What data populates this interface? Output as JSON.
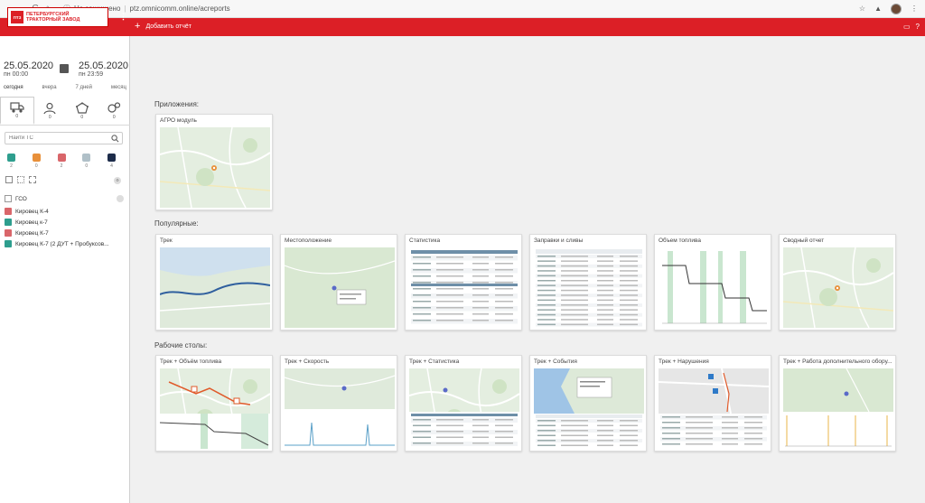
{
  "browser": {
    "back": "←",
    "forward": "→",
    "reload": "C",
    "home": "⌂",
    "security": "Не защищено",
    "url": "ptz.omnicomm.online/acreports"
  },
  "topbar": {
    "add_report": "Добавить отчёт",
    "add_icon": "+"
  },
  "logo": {
    "mark": "ПТЗ",
    "line1": "ПЕТЕРБУРГСКИЙ",
    "line2": "ТРАКТОРНЫЙ ЗАВОД"
  },
  "dates": {
    "from_date": "25.05.2020",
    "from_time": "пн 00:00",
    "to_date": "25.05.2020",
    "to_time": "пн 23:59"
  },
  "quick_ranges": [
    "сегодня",
    "вчера",
    "7 дней",
    "месяц"
  ],
  "tabs": [
    {
      "count": "0",
      "icon": "truck-icon"
    },
    {
      "count": "0",
      "icon": "driver-icon"
    },
    {
      "count": "0",
      "icon": "geozone-icon"
    },
    {
      "count": "0",
      "icon": "group-icon"
    }
  ],
  "search": {
    "placeholder": "Найти ТС"
  },
  "status_colors": [
    {
      "color": "#2e9e8e",
      "count": "2"
    },
    {
      "color": "#e8903a",
      "count": "0"
    },
    {
      "color": "#d9666a",
      "count": "2"
    },
    {
      "color": "#b0c0c8",
      "count": "0"
    },
    {
      "color": "#1d2c4a",
      "count": "4"
    }
  ],
  "group": {
    "label": "ГСО",
    "count": "0"
  },
  "vehicles": [
    {
      "label": "Кировец К-4",
      "color": "#d9666a"
    },
    {
      "label": "Кировец к-7",
      "color": "#2e9e8e"
    },
    {
      "label": "Кировец К-7",
      "color": "#d9666a"
    },
    {
      "label": "Кировец К-7 (2 ДУТ + Пробуксов...",
      "color": "#2e9e8e"
    }
  ],
  "sections": {
    "apps": "Приложения:",
    "popular": "Популярные:",
    "desktops": "Рабочие столы:"
  },
  "apps": [
    {
      "title": "АГРО модуль",
      "kind": "map"
    }
  ],
  "popular": [
    {
      "title": "Трек",
      "kind": "track"
    },
    {
      "title": "Местоположение",
      "kind": "location"
    },
    {
      "title": "Статистика",
      "kind": "stats"
    },
    {
      "title": "Заправки и сливы",
      "kind": "table"
    },
    {
      "title": "Объем топлива",
      "kind": "fuel"
    },
    {
      "title": "Сводный отчет",
      "kind": "map"
    }
  ],
  "desktops": [
    {
      "title": "Трек + Объём топлива",
      "kind": "track-fuel"
    },
    {
      "title": "Трек + Скорость",
      "kind": "track-speed"
    },
    {
      "title": "Трек + Статистика",
      "kind": "track-stats"
    },
    {
      "title": "Трек + События",
      "kind": "track-events"
    },
    {
      "title": "Трек + Нарушения",
      "kind": "track-violations"
    },
    {
      "title": "Трек + Работа дополнительного обору...",
      "kind": "track-equipment"
    }
  ]
}
